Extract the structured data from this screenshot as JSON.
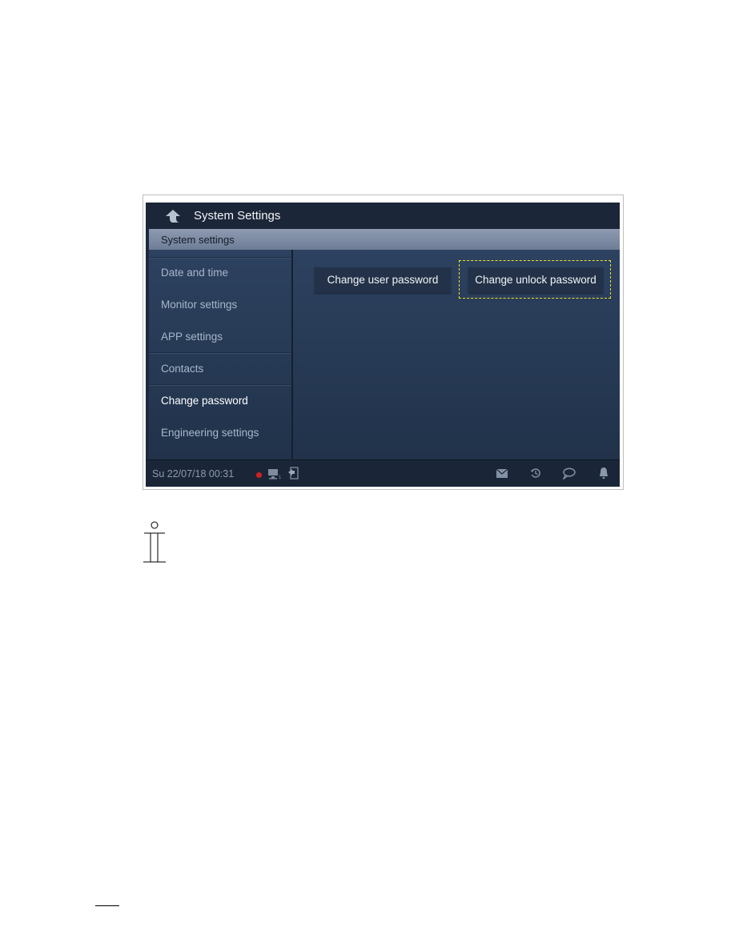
{
  "app": {
    "title": "System Settings",
    "section_header": "System settings"
  },
  "sidebar": {
    "items": [
      {
        "label": "Date and time",
        "active": false
      },
      {
        "label": "Monitor settings",
        "active": false
      },
      {
        "label": "APP settings",
        "active": false
      },
      {
        "label": "Contacts",
        "active": false
      },
      {
        "label": "Change password",
        "active": true
      },
      {
        "label": "Engineering settings",
        "active": false
      }
    ]
  },
  "main": {
    "buttons": [
      {
        "label": "Change user password",
        "highlighted": false
      },
      {
        "label": "Change unlock password",
        "highlighted": true
      }
    ],
    "highlight_color": "#e8e22c"
  },
  "statusbar": {
    "datetime": "Su 22/07/18  00:31",
    "indicator_color": "#d51f1f",
    "monitor_count": "1",
    "icons": [
      "status-dot",
      "monitor-icon",
      "exit-door-icon",
      "mail-icon",
      "history-icon",
      "chat-icon",
      "bell-icon"
    ]
  },
  "note": {
    "icon": "info-icon"
  }
}
